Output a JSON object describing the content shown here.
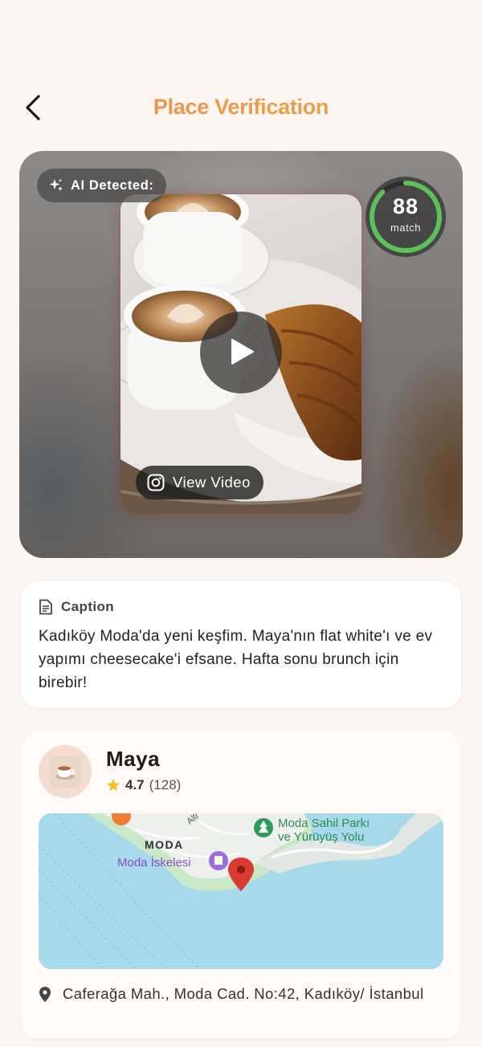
{
  "header": {
    "title": "Place Verification"
  },
  "media": {
    "ai_label": "AI Detected:",
    "match_score": "88",
    "match_fraction": 0.88,
    "match_label": "match",
    "view_video_label": "View Video"
  },
  "caption": {
    "heading": "Caption",
    "text": "Kadıköy Moda'da yeni keşfim. Maya'nın flat white'ı ve ev yapımı cheesecake'i efsane. Hafta sonu brunch için birebir!"
  },
  "place": {
    "name": "Maya",
    "rating": "4.7",
    "review_count": "(128)",
    "address": "Caferağa Mah., Moda Cad. No:42, Kadıköy/ İstanbul"
  },
  "map": {
    "district_label": "MODA",
    "pier_label": "Moda İskelesi",
    "park_label_line1": "Moda Sahil Parkı",
    "park_label_line2": "ve Yürüyüş Yolu",
    "street_fragment": "Alti"
  },
  "colors": {
    "accent_start": "#f08a44",
    "accent_end": "#e8ab4e",
    "match_ring": "#5cc15a",
    "pin_red": "#d93b30",
    "map_water": "#a6d9ea"
  }
}
